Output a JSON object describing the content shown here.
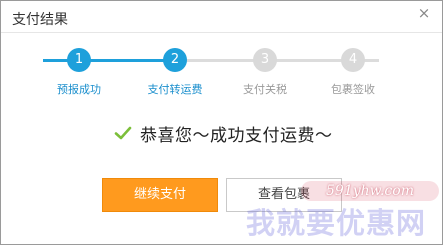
{
  "dialog": {
    "title": "支付结果",
    "close_symbol": "×"
  },
  "steps": [
    {
      "number": "1",
      "label": "预报成功",
      "state": "done"
    },
    {
      "number": "2",
      "label": "支付转运费",
      "state": "done"
    },
    {
      "number": "3",
      "label": "支付关税",
      "state": "todo"
    },
    {
      "number": "4",
      "label": "包裹签收",
      "state": "todo"
    }
  ],
  "result": {
    "icon": "check-icon",
    "message": "恭喜您～成功支付运费～"
  },
  "buttons": {
    "continue_label": "继续支付",
    "view_label": "查看包裹"
  },
  "watermark": {
    "url": "591yhw.com",
    "name": "我就要优惠网"
  },
  "colors": {
    "accent": "#1ea0db",
    "primary_button": "#ff9a1e",
    "inactive": "#d9d9d9"
  }
}
